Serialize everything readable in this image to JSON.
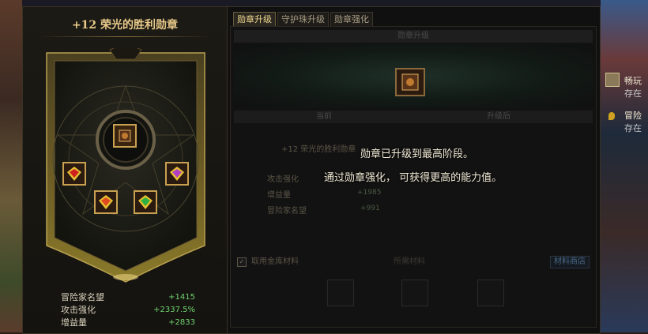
{
  "badge": {
    "title": "+12 荣光的胜利勋章",
    "stats": [
      {
        "label": "冒险家名望",
        "value": "+1415"
      },
      {
        "label": "攻击强化",
        "value": "+2337.5%"
      },
      {
        "label": "增益量",
        "value": "+2833"
      }
    ]
  },
  "tabs": [
    {
      "label": "勋章升级",
      "active": true
    },
    {
      "label": "守护珠升级",
      "active": false
    },
    {
      "label": "勋章强化",
      "active": false
    }
  ],
  "upgrade": {
    "section_header": "勋章升级",
    "col_current": "当前",
    "col_next": "升级后",
    "current_name": "+12 荣光的胜利勋章",
    "stats": [
      {
        "label": "攻击强化",
        "value": ""
      },
      {
        "label": "增益量",
        "value": "+1985"
      },
      {
        "label": "冒险家名望",
        "value": "+991"
      }
    ],
    "use_warehouse_label": "取用金库材料",
    "use_warehouse_checked": true,
    "required_materials": "所需材料",
    "material_shop": "材料商店"
  },
  "message": {
    "line1": "勋章已升级到最高阶段。",
    "line2": "通过勋章强化，  可获得更高的能力值。"
  },
  "world": {
    "quest1": "畅玩",
    "quest1_sub": "存在",
    "quest2": "冒险",
    "quest2_sub": "存在"
  },
  "colors": {
    "title_gold": "#e8c98a",
    "stat_green": "#6ed36e",
    "tab_active": "#f0d890"
  },
  "icons": {
    "badge_main": "badge-emblem-icon",
    "gems": [
      "red-gem-icon",
      "purple-gem-icon",
      "red-gem-icon",
      "green-gem-icon"
    ]
  }
}
